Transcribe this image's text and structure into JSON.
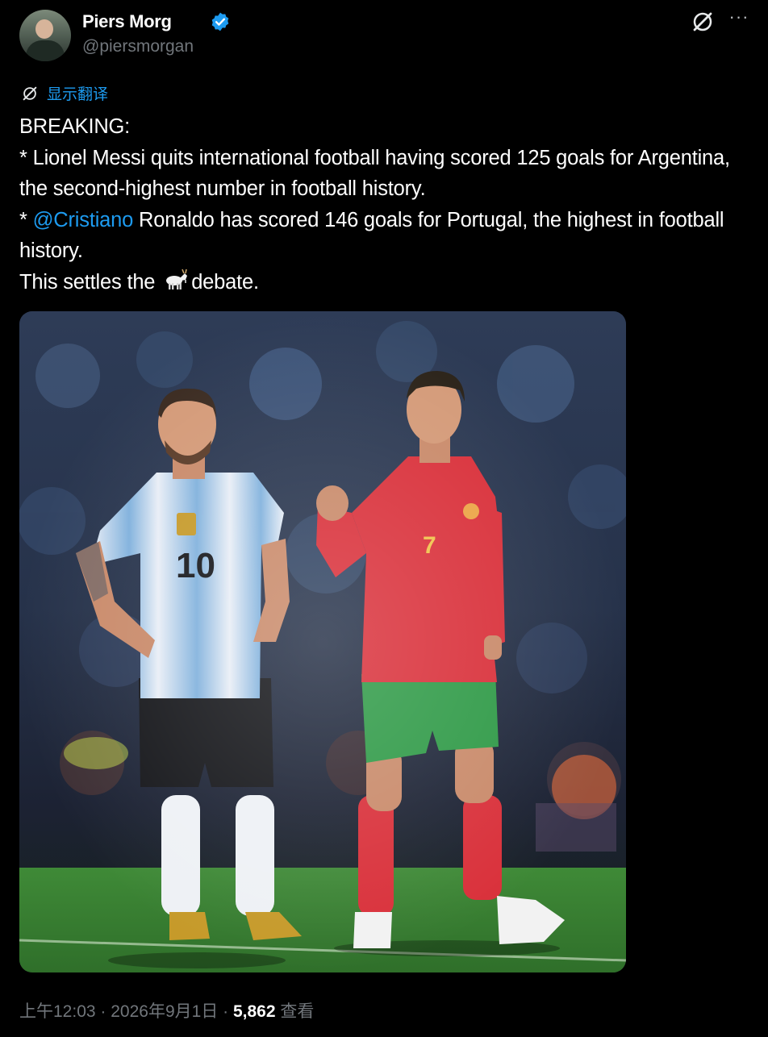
{
  "author": {
    "name": "Piers Morg",
    "handle": "@piersmorgan",
    "verified": true,
    "verified_color": "#1d9bf0"
  },
  "header_icons": [
    "grok-icon",
    "more-icon"
  ],
  "translate": {
    "icon": "grok-icon",
    "label": "显示翻译",
    "color": "#1d9bf0"
  },
  "tweet": {
    "line1": "BREAKING:",
    "line2": "* Lionel Messi quits international football having scored 125 goals for Argentina, the second-highest number in football history.",
    "line3_prefix": "* ",
    "mention": "@Cristiano",
    "line3_suffix": " Ronaldo has scored 146 goals for Portugal, the highest in football history.",
    "line4_before": "This settles the ",
    "line4_emoji": "goat-emoji",
    "line4_after": "debate."
  },
  "media": {
    "type": "photo",
    "left_player_number": "10",
    "right_player_number": "7"
  },
  "footer": {
    "time": "上午12:03",
    "sep1": " · ",
    "date": "2026年9月1日",
    "sep2": " · ",
    "views": "5,862",
    "views_label": " 查看"
  },
  "colors": {
    "background": "#000000",
    "text": "#ffffff",
    "muted": "#71767b",
    "link": "#1d9bf0"
  }
}
